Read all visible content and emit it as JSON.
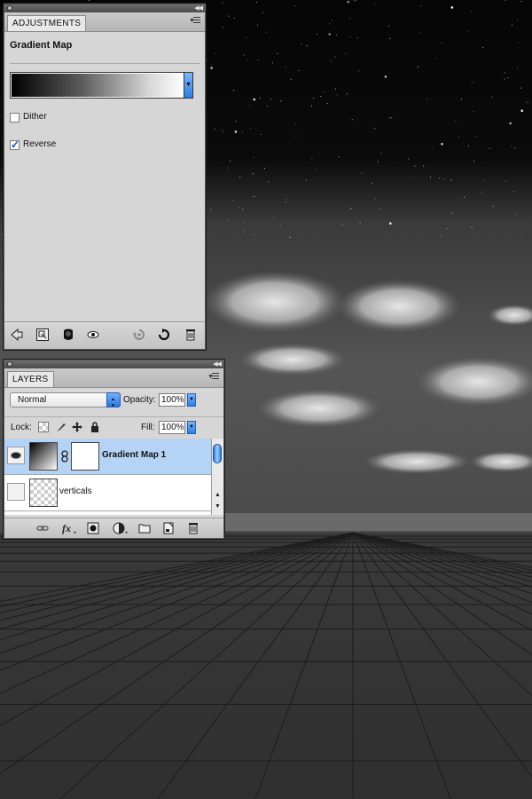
{
  "adjustments": {
    "tab_label": "ADJUSTMENTS",
    "title": "Gradient Map",
    "dither_label": "Dither",
    "dither_checked": false,
    "reverse_label": "Reverse",
    "reverse_checked": true,
    "footer_icons": [
      "back-arrow-icon",
      "expand-view-icon",
      "mask-icon",
      "eye-icon",
      "previous-state-icon",
      "reset-icon",
      "trash-icon"
    ]
  },
  "layers": {
    "tab_label": "LAYERS",
    "blend_mode": "Normal",
    "opacity_label": "Opacity:",
    "opacity_value": "100%",
    "lock_label": "Lock:",
    "fill_label": "Fill:",
    "fill_value": "100%",
    "items": [
      {
        "name": "Gradient Map 1",
        "visible": true,
        "selected": true
      },
      {
        "name": "verticals",
        "visible": false,
        "selected": false
      }
    ],
    "footer_icons": [
      "link-layers-icon",
      "fx-icon",
      "add-mask-icon",
      "adjustment-layer-icon",
      "new-group-icon",
      "new-layer-icon",
      "delete-layer-icon"
    ]
  },
  "colors": {
    "panel_bg": "#d6d6d6",
    "selection": "#b5d3f5",
    "accent_blue": "#2d7fe0"
  }
}
